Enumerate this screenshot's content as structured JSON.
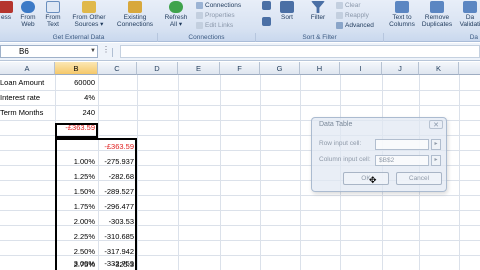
{
  "ribbon": {
    "buttons": [
      {
        "label": "From\nAccess",
        "display": "ess",
        "color": "#b5352e"
      },
      {
        "label": "From\nWeb",
        "display": "From\nWeb",
        "color": "#3c7ac7"
      },
      {
        "label": "From\nText",
        "display": "From\nText",
        "color": "#6a8fbf"
      },
      {
        "label": "From Other\nSources ▾",
        "display": "From Other\nSources ▾",
        "color": "#e0b84a"
      },
      {
        "label": "Existing\nConnections",
        "display": "Existing\nConnections",
        "color": "#d8a83c"
      },
      {
        "label": "Refresh\nAll ▾",
        "display": "Refresh\nAll ▾",
        "color": "#3fa34d"
      },
      {
        "label": "Sort",
        "display": "Sort",
        "color": "#4a6fa5"
      },
      {
        "label": "Filter",
        "display": "Filter",
        "color": "#4a6fa5"
      },
      {
        "label": "Text to\nColumns",
        "display": "Text to\nColumns",
        "color": "#5b86c2"
      },
      {
        "label": "Remove\nDuplicates",
        "display": "Remove\nDuplicates",
        "color": "#5b86c2"
      },
      {
        "label": "Data\nValidati",
        "display": "Da\nValidati",
        "color": "#5b86c2"
      }
    ],
    "small_buttons": [
      {
        "label": "Connections",
        "enabled": true
      },
      {
        "label": "Properties",
        "enabled": false
      },
      {
        "label": "Edit Links",
        "enabled": false
      },
      {
        "label": "Clear",
        "enabled": false
      },
      {
        "label": "Reapply",
        "enabled": false
      },
      {
        "label": "Advanced",
        "enabled": true
      }
    ],
    "groups": [
      "Get External Data",
      "Connections",
      "Sort & Filter",
      "Da"
    ]
  },
  "formula_bar": {
    "name_box": "B6",
    "formula": ""
  },
  "columns": [
    "A",
    "B",
    "C",
    "D",
    "E",
    "F",
    "G",
    "H",
    "I",
    "J",
    "K"
  ],
  "selected_column": "B",
  "cells": {
    "a1": "Loan Amount",
    "b1": "60000",
    "a2": "Interest rate",
    "b2": "4%",
    "a3": "Term Months",
    "b3": "240",
    "b4": "-£363.59",
    "c6": "-£363.59",
    "rates": [
      "1.00%",
      "1.25%",
      "1.50%",
      "1.75%",
      "2.00%",
      "2.25%",
      "2.50%",
      "2.75%",
      "3.00%"
    ],
    "payments": [
      "-275.937",
      "-282.68",
      "-289.527",
      "-296.477",
      "-303.53",
      "-310.685",
      "-317.942",
      "-325.3",
      "-332.759"
    ]
  },
  "colors": {
    "accent_red": "#e02020",
    "selected_header": "#f5c86a"
  },
  "dialog": {
    "title": "Data Table",
    "close": "✕",
    "row_input_label": "Row input cell:",
    "row_input_value": "",
    "column_input_label": "Column input cell:",
    "column_input_value": "$B$2",
    "ok_label": "OK",
    "cancel_label": "Cancel"
  },
  "icons": {
    "ref_button": "collapse-dialog-icon",
    "cursor": "mouse-pointer-icon"
  }
}
